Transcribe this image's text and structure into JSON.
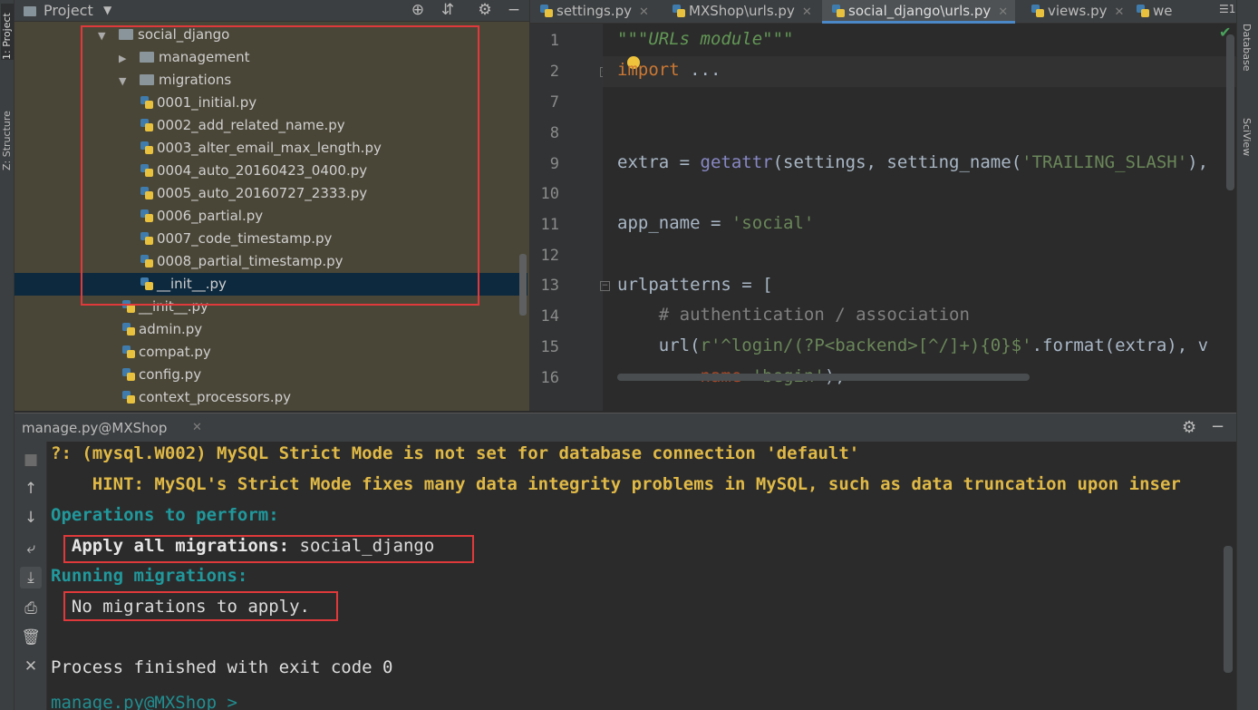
{
  "left_strip": {
    "project_tab": "1: Project",
    "structure_tab": "Z: Structure"
  },
  "right_strip": {
    "database_tab": "Database",
    "sciview_tab": "SciView"
  },
  "project_panel": {
    "title": "Project",
    "tree": [
      {
        "label": "social_django",
        "type": "folder",
        "expanded": true
      },
      {
        "label": "management",
        "type": "folder",
        "expanded": false
      },
      {
        "label": "migrations",
        "type": "folder",
        "expanded": true
      },
      {
        "label": "0001_initial.py",
        "type": "python-file"
      },
      {
        "label": "0002_add_related_name.py",
        "type": "python-file"
      },
      {
        "label": "0003_alter_email_max_length.py",
        "type": "python-file"
      },
      {
        "label": "0004_auto_20160423_0400.py",
        "type": "python-file"
      },
      {
        "label": "0005_auto_20160727_2333.py",
        "type": "python-file"
      },
      {
        "label": "0006_partial.py",
        "type": "python-file"
      },
      {
        "label": "0007_code_timestamp.py",
        "type": "python-file"
      },
      {
        "label": "0008_partial_timestamp.py",
        "type": "python-file"
      },
      {
        "label": "__init__.py",
        "type": "python-file",
        "selected": true
      },
      {
        "label": "__init__.py",
        "type": "python-file"
      },
      {
        "label": "admin.py",
        "type": "python-file"
      },
      {
        "label": "compat.py",
        "type": "python-file"
      },
      {
        "label": "config.py",
        "type": "python-file"
      },
      {
        "label": "context_processors.py",
        "type": "python-file"
      }
    ]
  },
  "editor": {
    "tabs": [
      {
        "label": "settings.py",
        "active": false
      },
      {
        "label": "MXShop\\urls.py",
        "active": false
      },
      {
        "label": "social_django\\urls.py",
        "active": true
      },
      {
        "label": "views.py",
        "active": false
      },
      {
        "label": "we",
        "active": false
      }
    ],
    "tab_overflow": "1",
    "line_numbers": [
      "1",
      "2",
      "7",
      "8",
      "9",
      "10",
      "11",
      "12",
      "13",
      "14",
      "15",
      "16"
    ],
    "code": {
      "l1": "\"\"\"URLs module\"\"\"",
      "l2_kw": "import",
      "l2_rest": " ...",
      "l9_a": "extra = ",
      "l9_fn": "getattr",
      "l9_b": "(settings, setting_name(",
      "l9_str": "'TRAILING_SLASH'",
      "l9_c": "), ",
      "l11_a": "app_name = ",
      "l11_str": "'social'",
      "l13": "urlpatterns = [",
      "l14": "    # authentication / association",
      "l15_a": "    url(",
      "l15_str": "r'^login/(?P<backend>[^/]+){0}$'",
      "l15_b": ".format(extra), v",
      "l16_param": "        name",
      "l16_a": "=",
      "l16_str": "'begin'",
      "l16_b": "),"
    }
  },
  "run_panel": {
    "tab_label": "manage.py@MXShop",
    "console": [
      {
        "text": "?: (mysql.W002) MySQL Strict Mode is not set for database connection 'default'",
        "style": "warn"
      },
      {
        "text": "    HINT: MySQL's Strict Mode fixes many data integrity problems in MySQL, such as data truncation upon inser",
        "style": "warn"
      },
      {
        "text": "Operations to perform:",
        "style": "cyan"
      },
      {
        "text_bold": "  Apply all migrations:",
        "text_plain": " social_django",
        "style": "mixed"
      },
      {
        "text": "Running migrations:",
        "style": "cyan"
      },
      {
        "text": "  No migrations to apply.",
        "style": "plain"
      },
      {
        "text": "",
        "style": "plain"
      },
      {
        "text": "Process finished with exit code 0",
        "style": "plain"
      },
      {
        "text": "manage.py@MXShop >",
        "style": "faded"
      }
    ]
  },
  "colors": {
    "highlight_box": "#e0393b",
    "project_bg": "#4a4637",
    "editor_bg": "#2b2b2b",
    "selection": "#0d293e"
  }
}
